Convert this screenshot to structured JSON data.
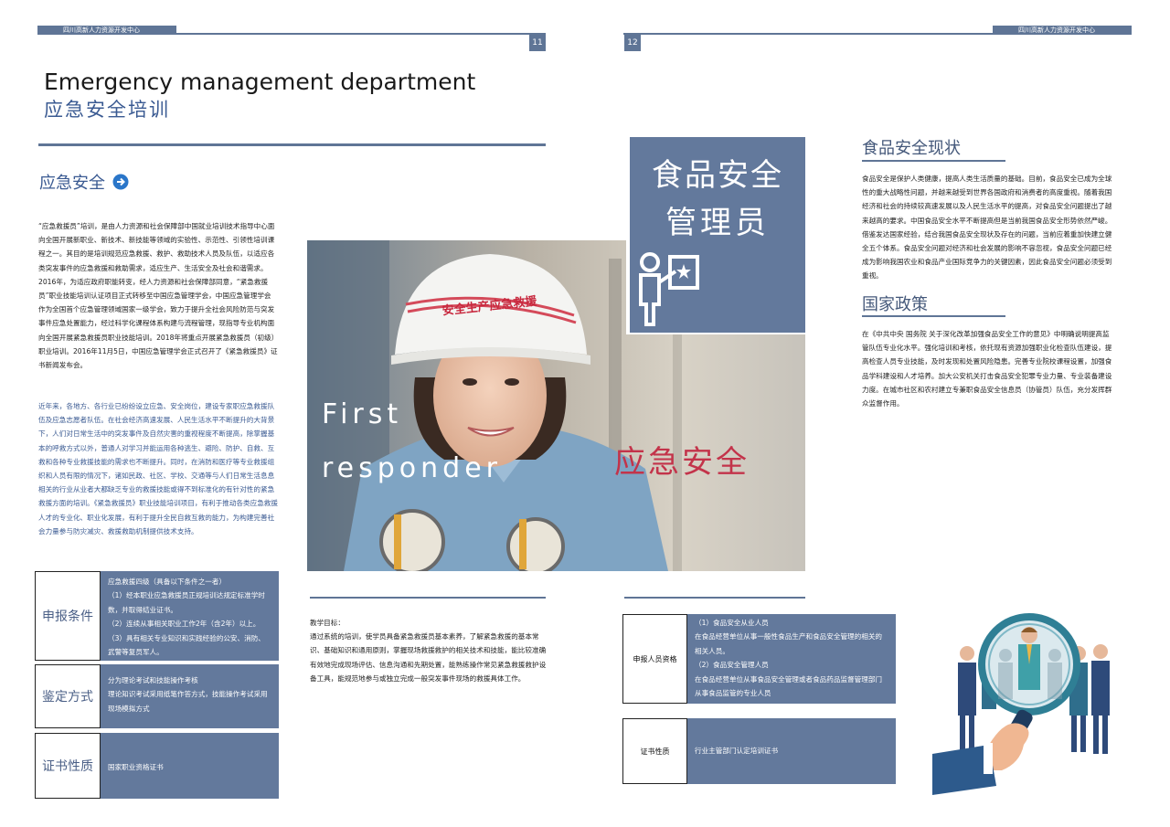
{
  "header": {
    "org_name": "四川高新人力资源开发中心",
    "page_left": "11",
    "page_right": "12"
  },
  "left": {
    "title_en": "Emergency management department",
    "title_cn": "应急安全培训",
    "section_heading": "应急安全",
    "paragraph1": "“应急救援员”培训，是由人力资源和社会保障部中国就业培训技术指导中心面向全国开展新职业、新技术、新技能等领域的实验性、示范性、引领性培训课程之一。其目的是培训规范应急救援、救护、救助技术人员及队伍，以适应各类突发事件的应急救援和救助需求，适应生产、生活安全及社会和谐需求。\n2016年，为适应政府职能转变，经人力资源和社会保障部同意，“紧急救援员”职业技能培训认证项目正式转移至中国应急管理学会，中国应急管理学会作为全国首个应急管理领域国家一级学会，致力于提升全社会风险防范与突发事件应急处置能力，经过科学化课程体系构建与流程管理，现指导专业机构面向全国开展紧急救援员职业技能培训。2018年将重点开展紧急救援员（初级）职业培训。2016年11月5日，中国应急管理学会正式召开了《紧急救援员》证书新闻发布会。",
    "paragraph2": "近年来，各地方、各行业已纷纷设立应急、安全岗位，建设专家职应急救援队伍及应急志愿者队伍。在社会经济高速发展、人民生活水平不断提升的大背景下，人们对日常生活中的突发事件及自然灾害的重视程度不断提高，除掌握基本的呼救方式以外，普通人对学习并能运用各种逃生、避险、防护、自救、互救和各种专业救援技能的需求也不断提升。同时，在消防和医疗等专业救援组织和人员有限的情况下，诸如民政、社区、学校、交通等与人们日常生活息息相关的行业从业者大都缺乏专业的救援技能或得不到标准化的有针对性的紧急救援方面的培训。《紧急救援员》职业技能培训项目，有利于推动各类应急救援人才的专业化、职业化发展，有利于提升全民自救互救的能力，为构建完善社会力量参与防灾减灾、救援救助机制提供技术支持。",
    "rows": [
      {
        "label": "申报条件",
        "content": "应急救援四级（具备以下条件之一者）\n（1）经本职业应急救援员正规培训达规定标准学时数，并取得结业证书。\n（2）连续从事相关职业工作2年（含2年）以上。\n（3）具有相关专业知识和实践经验的公安、消防、武警等复员军人。"
      },
      {
        "label": "鉴定方式",
        "content": "分为理论考试和技能操作考核\n理论知识考试采用纸笔作答方式，技能操作考试采用现场模拟方式"
      },
      {
        "label": "证书性质",
        "content": "国家职业资格证书"
      }
    ]
  },
  "center": {
    "hero_en_line1": "First",
    "hero_en_line2": "responder",
    "hero_cn": "应急安全",
    "helmet_text": "安全生产应急救援",
    "badge_line1": "食品安全",
    "badge_line2": "管理员",
    "teaching_goal": "教学目标：\n通过系统的培训，使学员具备紧急救援员基本素养，了解紧急救援的基本常识、基础知识和通用原则，掌握现场救援救护的相关技术和技能，能比较准确有效地完成现场评估、信息沟通和先期处置，能熟练操作常见紧急救援救护设备工具，能规范地参与或独立完成一般突发事件现场的救援具体工作。"
  },
  "right": {
    "heading1": "食品安全现状",
    "paragraph1": "食品安全是保护人类健康，提高人类生活质量的基础。目前，食品安全已成为全球性的重大战略性问题，并越来越受到世界各国政府和消费者的高度重视。随着我国经济和社会的持续较高速发展以及人民生活水平的提高，对食品安全问题提出了越来越高的要求。中国食品安全水平不断提高但是当前我国食品安全形势依然严峻。借鉴发达国家经验，结合我国食品安全现状及存在的问题，当前应着重加快建立健全五个体系。食品安全问题对经济和社会发展的影响不容忽视，食品安全问题已经成为影响我国农业和食品产业国际竞争力的关键因素，因此食品安全问题必须受到重视。",
    "heading2": "国家政策",
    "paragraph2": "在《中共中央 国务院 关于深化改革加强食品安全工作的意见》中明确说明提高监管队伍专业化水平。强化培训和考核，依托现有资源加强职业化检查队伍建设，提高检查人员专业技能，及时发现和处置风险隐患。完善专业院校课程设置，加强食品学科建设和人才培养。加大公安机关打击食品安全犯罪专业力量、专业装备建设力度。在城市社区和农村建立专兼职食品安全信息员（协管员）队伍，充分发挥群众监督作用。",
    "rows": [
      {
        "label": "申报人员资格",
        "content": "（1）食品安全从业人员\n在食品经营单位从事一般性食品生产和食品安全管理的相关的相关人员。\n（2）食品安全管理人员\n在食品经营单位从事食品安全管理或者食品药品监督管理部门从事食品监管的专业人员"
      },
      {
        "label": "证书性质",
        "content": "行业主管部门认定培训证书"
      }
    ]
  },
  "colors": {
    "accent_blue": "#63799c",
    "heading_blue": "#3a5a92",
    "hero_red": "#c3334a"
  }
}
